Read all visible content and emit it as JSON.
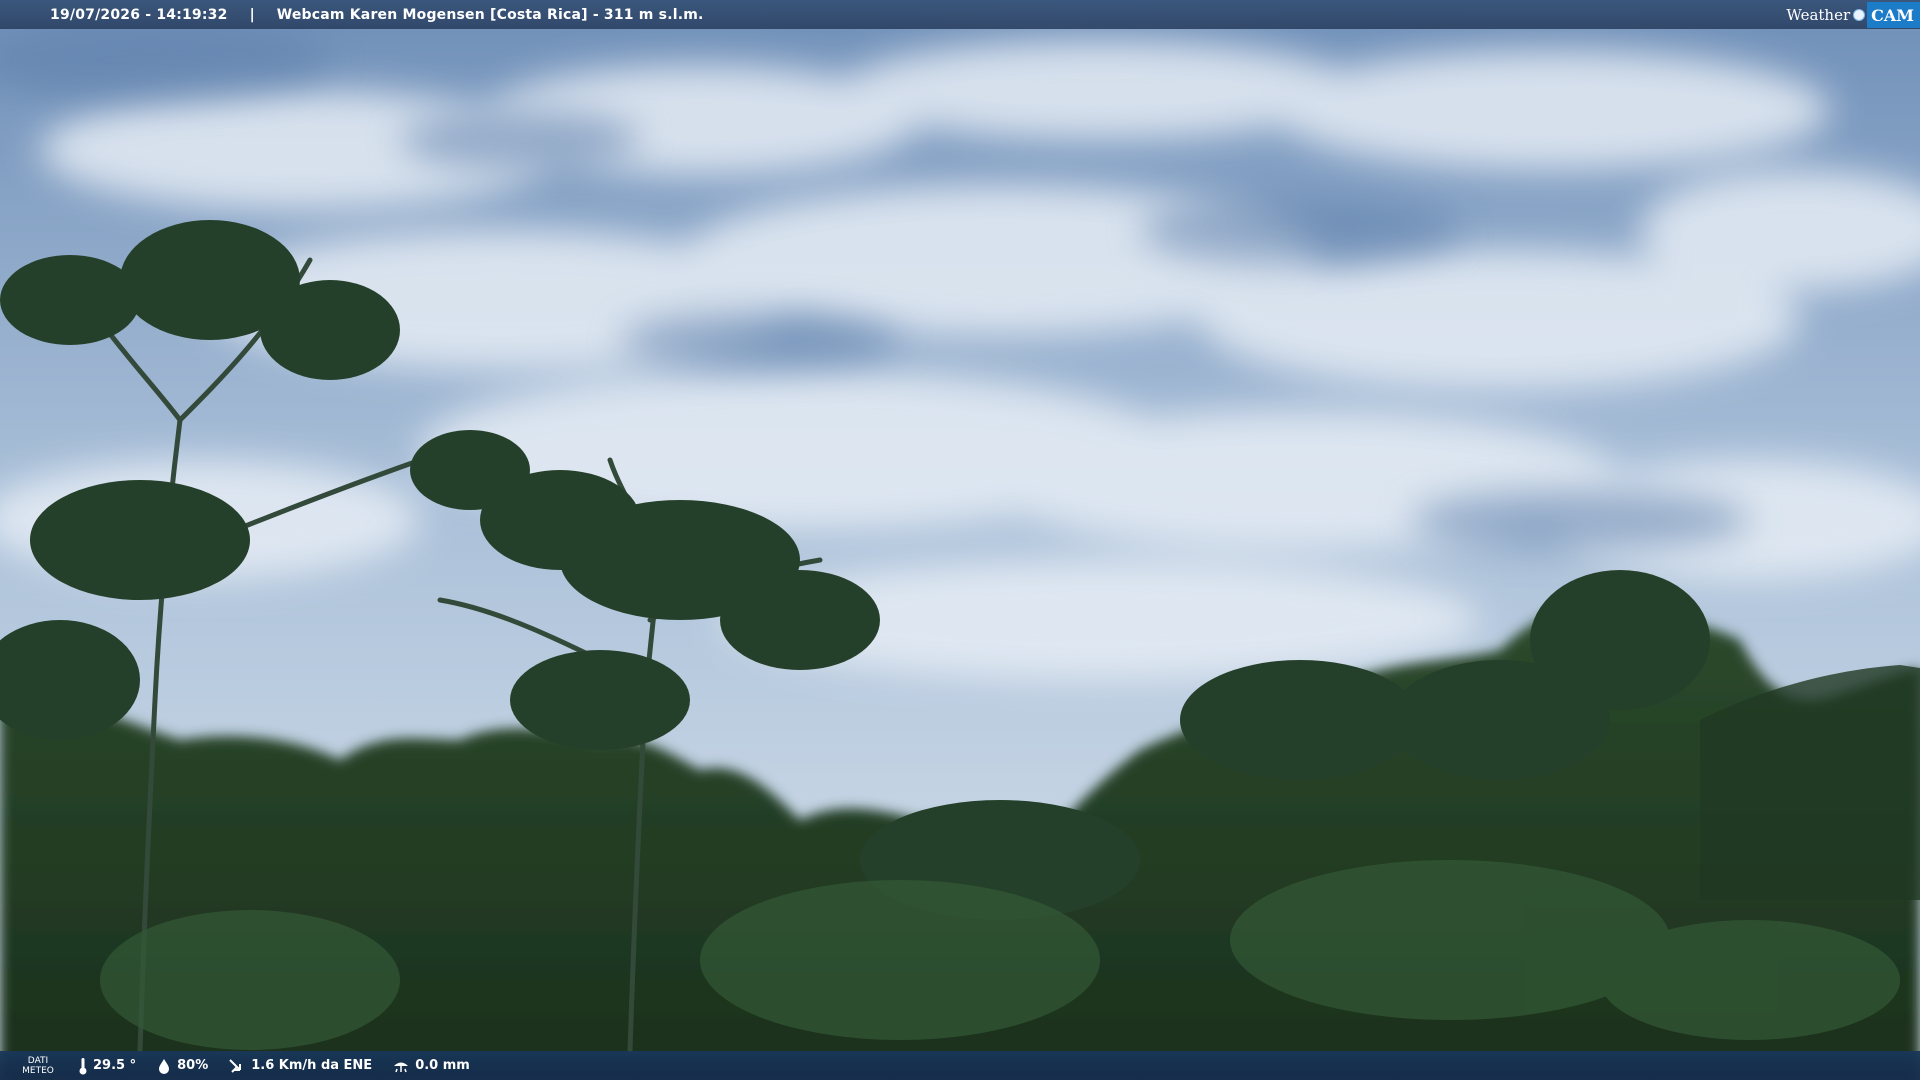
{
  "header": {
    "timestamp": "19/07/2026 - 14:19:32",
    "separator": "|",
    "location": "Webcam Karen Mogensen [Costa Rica]  -  311 m s.l.m."
  },
  "logo": {
    "weather": "Weather",
    "cam": "CAM"
  },
  "weather_bar": {
    "label_line1": "DATI",
    "label_line2": "METEO",
    "temperature": "29.5 °",
    "humidity": "80%",
    "wind": "1.6 Km/h da ENE",
    "rain": "0.0 mm"
  },
  "colors": {
    "accent": "#1c7cc8",
    "bar": "#2a4a72"
  }
}
